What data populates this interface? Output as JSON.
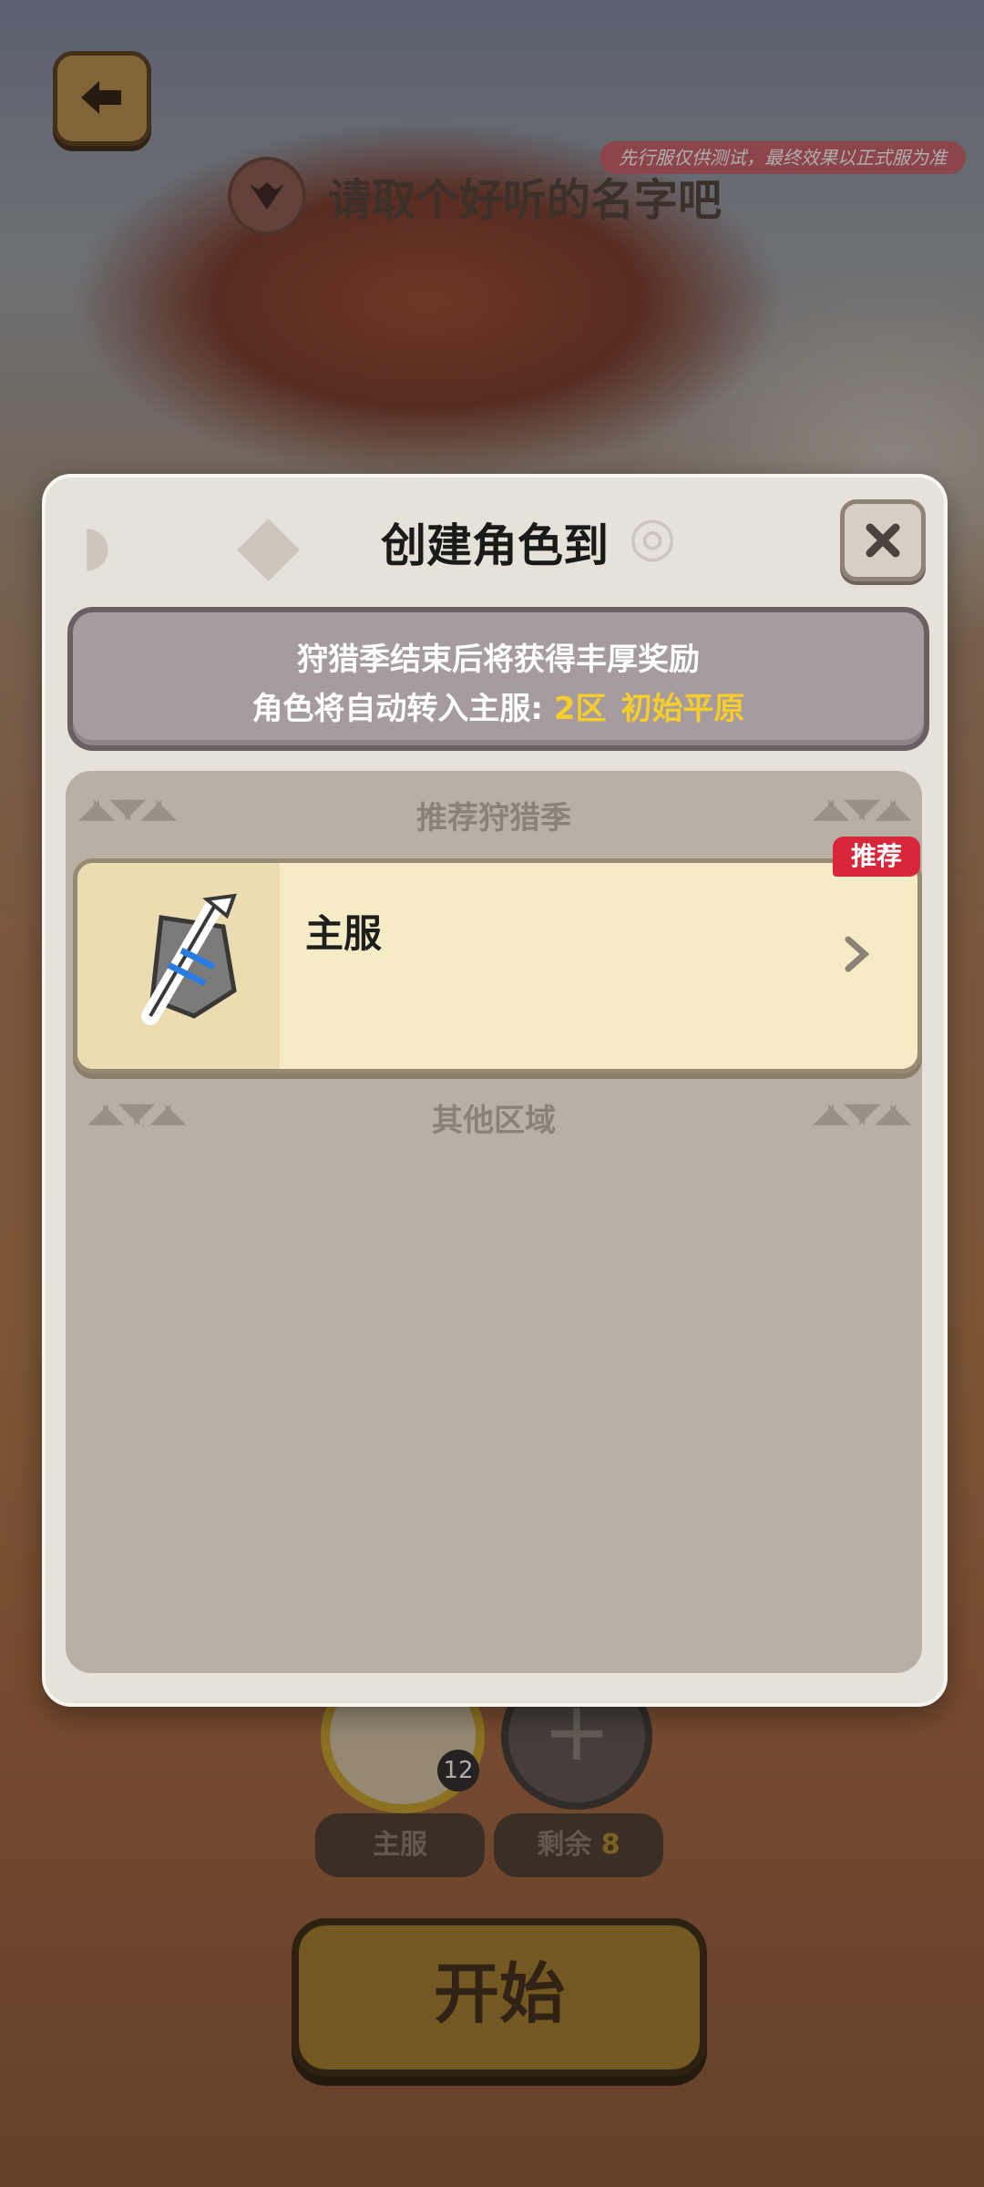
{
  "top": {
    "test_notice": "先行服仅供测试，最终效果以正式服为准",
    "name_prompt": "请取个好听的名字吧"
  },
  "dialog": {
    "title": "创建角色到",
    "info": {
      "line1": "狩猎季结束后将获得丰厚奖励",
      "line2_prefix": "角色将自动转入主服: ",
      "line2_zone": "2区",
      "line2_place": "初始平原"
    },
    "recommended_header": "推荐狩猎季",
    "recommended_badge": "推荐",
    "server_name": "主服",
    "other_header": "其他区域"
  },
  "bottom": {
    "avatar_level": "12",
    "server_pill": "主服",
    "remaining_label": "剩余",
    "remaining_count": "8",
    "add_symbol": "+",
    "start_button": "开始"
  },
  "colors": {
    "highlight_yellow": "#f6cd2b",
    "badge_red": "#d8263a",
    "card_cream": "#f5ebc4",
    "panel_gray": "#a69ca0"
  },
  "icons": [
    "back-arrow-icon",
    "close-icon",
    "sword-shield-icon",
    "chevron-right-icon",
    "emblem-icon"
  ]
}
